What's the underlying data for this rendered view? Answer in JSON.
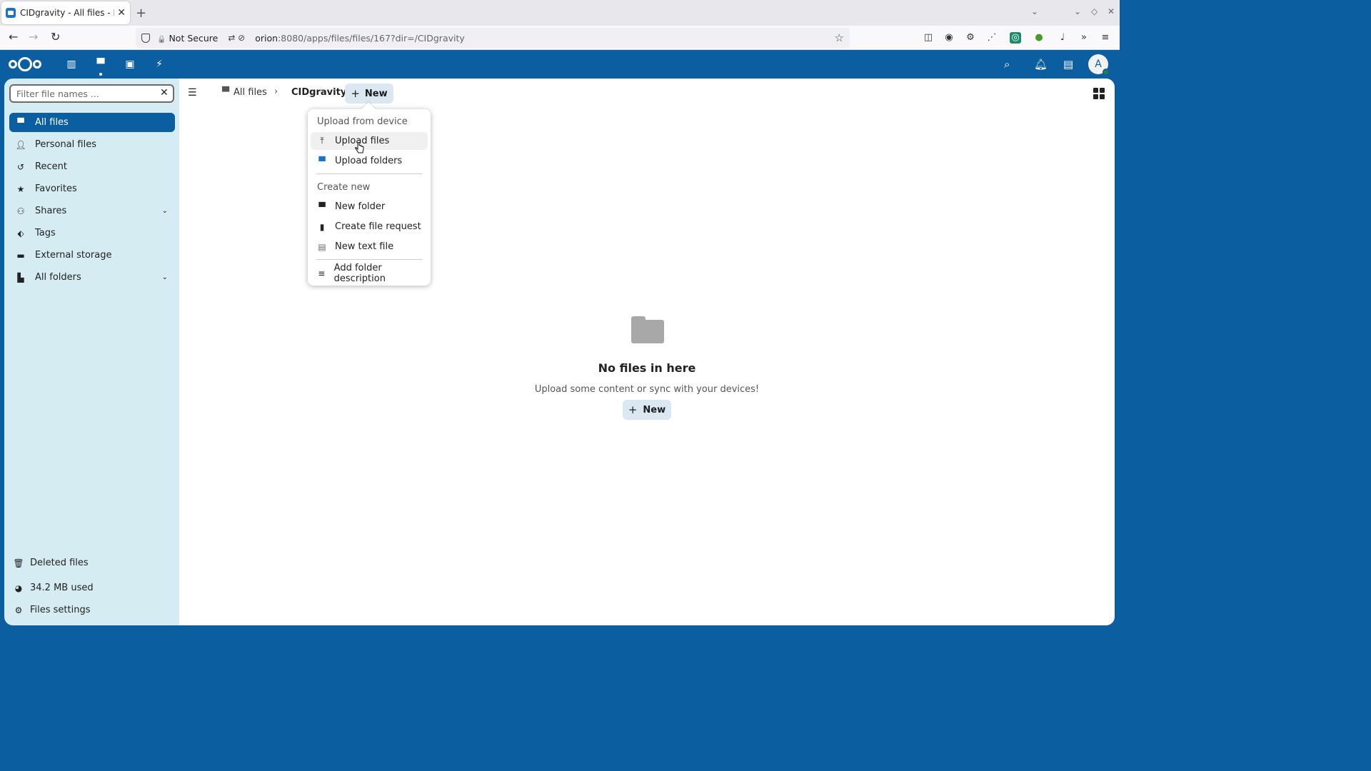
{
  "browser": {
    "tab_title": "CIDgravity - All files - Nextc",
    "url_security": "Not Secure",
    "url_host": "orion",
    "url_path": ":8080/apps/files/files/167?dir=/CIDgravity"
  },
  "sidebar": {
    "filter_placeholder": "Filter file names ...",
    "items": [
      {
        "label": "All files",
        "icon": "folder-icon"
      },
      {
        "label": "Personal files",
        "icon": "person-icon"
      },
      {
        "label": "Recent",
        "icon": "history-icon"
      },
      {
        "label": "Favorites",
        "icon": "star-icon"
      },
      {
        "label": "Shares",
        "icon": "share-icon"
      },
      {
        "label": "Tags",
        "icon": "tag-icon"
      },
      {
        "label": "External storage",
        "icon": "storage-icon"
      },
      {
        "label": "All folders",
        "icon": "folders-icon"
      }
    ],
    "footer": {
      "deleted": "Deleted files",
      "quota": "34.2 MB used",
      "settings": "Files settings"
    }
  },
  "breadcrumb": {
    "root": "All files",
    "current": "CIDgravity",
    "new_label": "New"
  },
  "menu": {
    "upload_caption": "Upload from device",
    "upload_files": "Upload files",
    "upload_folders": "Upload folders",
    "create_caption": "Create new",
    "new_folder": "New folder",
    "file_request": "Create file request",
    "new_text_file": "New text file",
    "folder_description": "Add folder description"
  },
  "empty": {
    "title": "No files in here",
    "description": "Upload some content or sync with your devices!",
    "new_label": "New"
  },
  "user": {
    "avatar_letter": "A"
  },
  "colors": {
    "brand": "#0b5fa0",
    "sidebar_bg": "#d6ecf3"
  }
}
